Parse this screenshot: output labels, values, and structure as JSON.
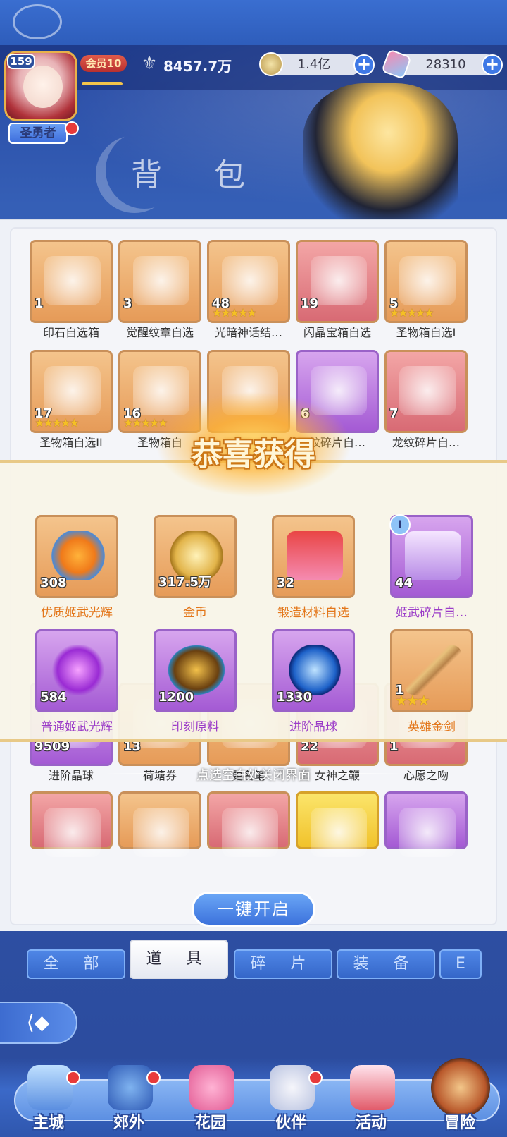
{
  "player": {
    "level": "159",
    "title": "圣勇者",
    "vip": "会员10",
    "vip_progress": 0.9,
    "power": "8457.7万"
  },
  "resources": {
    "gold": "1.4亿",
    "gems": "28310"
  },
  "page_title": "背 包",
  "bag_items": [
    {
      "name": "印石自选箱",
      "count": "1",
      "color": "orange",
      "stars": 0
    },
    {
      "name": "觉醒纹章自选",
      "count": "3",
      "color": "orange",
      "stars": 0
    },
    {
      "name": "光暗神话结…",
      "count": "48",
      "color": "orange",
      "stars": 5
    },
    {
      "name": "闪晶宝箱自选",
      "count": "19",
      "color": "red",
      "stars": 0
    },
    {
      "name": "圣物箱自选I",
      "count": "5",
      "color": "orange",
      "stars": 5
    },
    {
      "name": "圣物箱自选II",
      "count": "17",
      "color": "orange",
      "stars": 5
    },
    {
      "name": "圣物箱自",
      "count": "16",
      "color": "orange",
      "stars": 5
    },
    {
      "name": "",
      "count": "",
      "color": "orange",
      "stars": 0
    },
    {
      "name": "纹碎片自…",
      "count": "6",
      "color": "purple",
      "stars": 0
    },
    {
      "name": "龙纹碎片自…",
      "count": "7",
      "color": "red",
      "stars": 0
    },
    {
      "name": "进阶晶球",
      "count": "9509",
      "color": "purple",
      "stars": 0
    },
    {
      "name": "荷塘券",
      "count": "13",
      "color": "orange",
      "stars": 0
    },
    {
      "name": "更名笔",
      "count": "",
      "color": "orange",
      "stars": 0
    },
    {
      "name": "女神之鞭",
      "count": "22",
      "color": "red",
      "stars": 0
    },
    {
      "name": "心愿之吻",
      "count": "1",
      "color": "red",
      "stars": 0
    },
    {
      "name": "",
      "count": "",
      "color": "red",
      "stars": 0
    },
    {
      "name": "",
      "count": "",
      "color": "orange",
      "stars": 0
    },
    {
      "name": "",
      "count": "",
      "color": "red",
      "stars": 0
    },
    {
      "name": "",
      "count": "",
      "color": "yellow",
      "stars": 0
    },
    {
      "name": "",
      "count": "",
      "color": "purple",
      "stars": 0
    }
  ],
  "open_all_label": "一键开启",
  "tabs": [
    "全 部",
    "道 具",
    "碎 片",
    "装 备",
    "E"
  ],
  "active_tab": 1,
  "nav": [
    {
      "label": "主城",
      "dot": true
    },
    {
      "label": "郊外",
      "dot": true
    },
    {
      "label": "花园",
      "dot": false
    },
    {
      "label": "伙伴",
      "dot": true
    },
    {
      "label": "活动",
      "dot": false
    },
    {
      "label": "冒险",
      "dot": false
    }
  ],
  "reward_popup": {
    "title": "恭喜获得",
    "close_hint": "点选空白处关闭界面",
    "items": [
      {
        "name": "优质姬武光辉",
        "count": "308",
        "color": "orange",
        "stars": 0
      },
      {
        "name": "金币",
        "count": "317.5万",
        "color": "orange",
        "stars": 0
      },
      {
        "name": "锻造材料自选",
        "count": "32",
        "color": "orange",
        "stars": 0
      },
      {
        "name": "姬武碎片自…",
        "count": "44",
        "color": "purple",
        "stars": 0,
        "badge": "I"
      },
      {
        "name": "普通姬武光辉",
        "count": "584",
        "color": "purple",
        "stars": 0
      },
      {
        "name": "印刻原料",
        "count": "1200",
        "color": "purple",
        "stars": 0
      },
      {
        "name": "进阶晶球",
        "count": "1330",
        "color": "purple",
        "stars": 0
      },
      {
        "name": "英雄金剑",
        "count": "1",
        "color": "orange",
        "stars": 3
      }
    ]
  },
  "icons": {
    "gold": "gold-coin-icon",
    "gem": "gem-icon",
    "power": "winged-power-icon",
    "back": "back-arrow-icon"
  },
  "colors": {
    "orange_label": "#e3771b",
    "purple_label": "#9b3cc8",
    "accent": "#3c72dc"
  }
}
